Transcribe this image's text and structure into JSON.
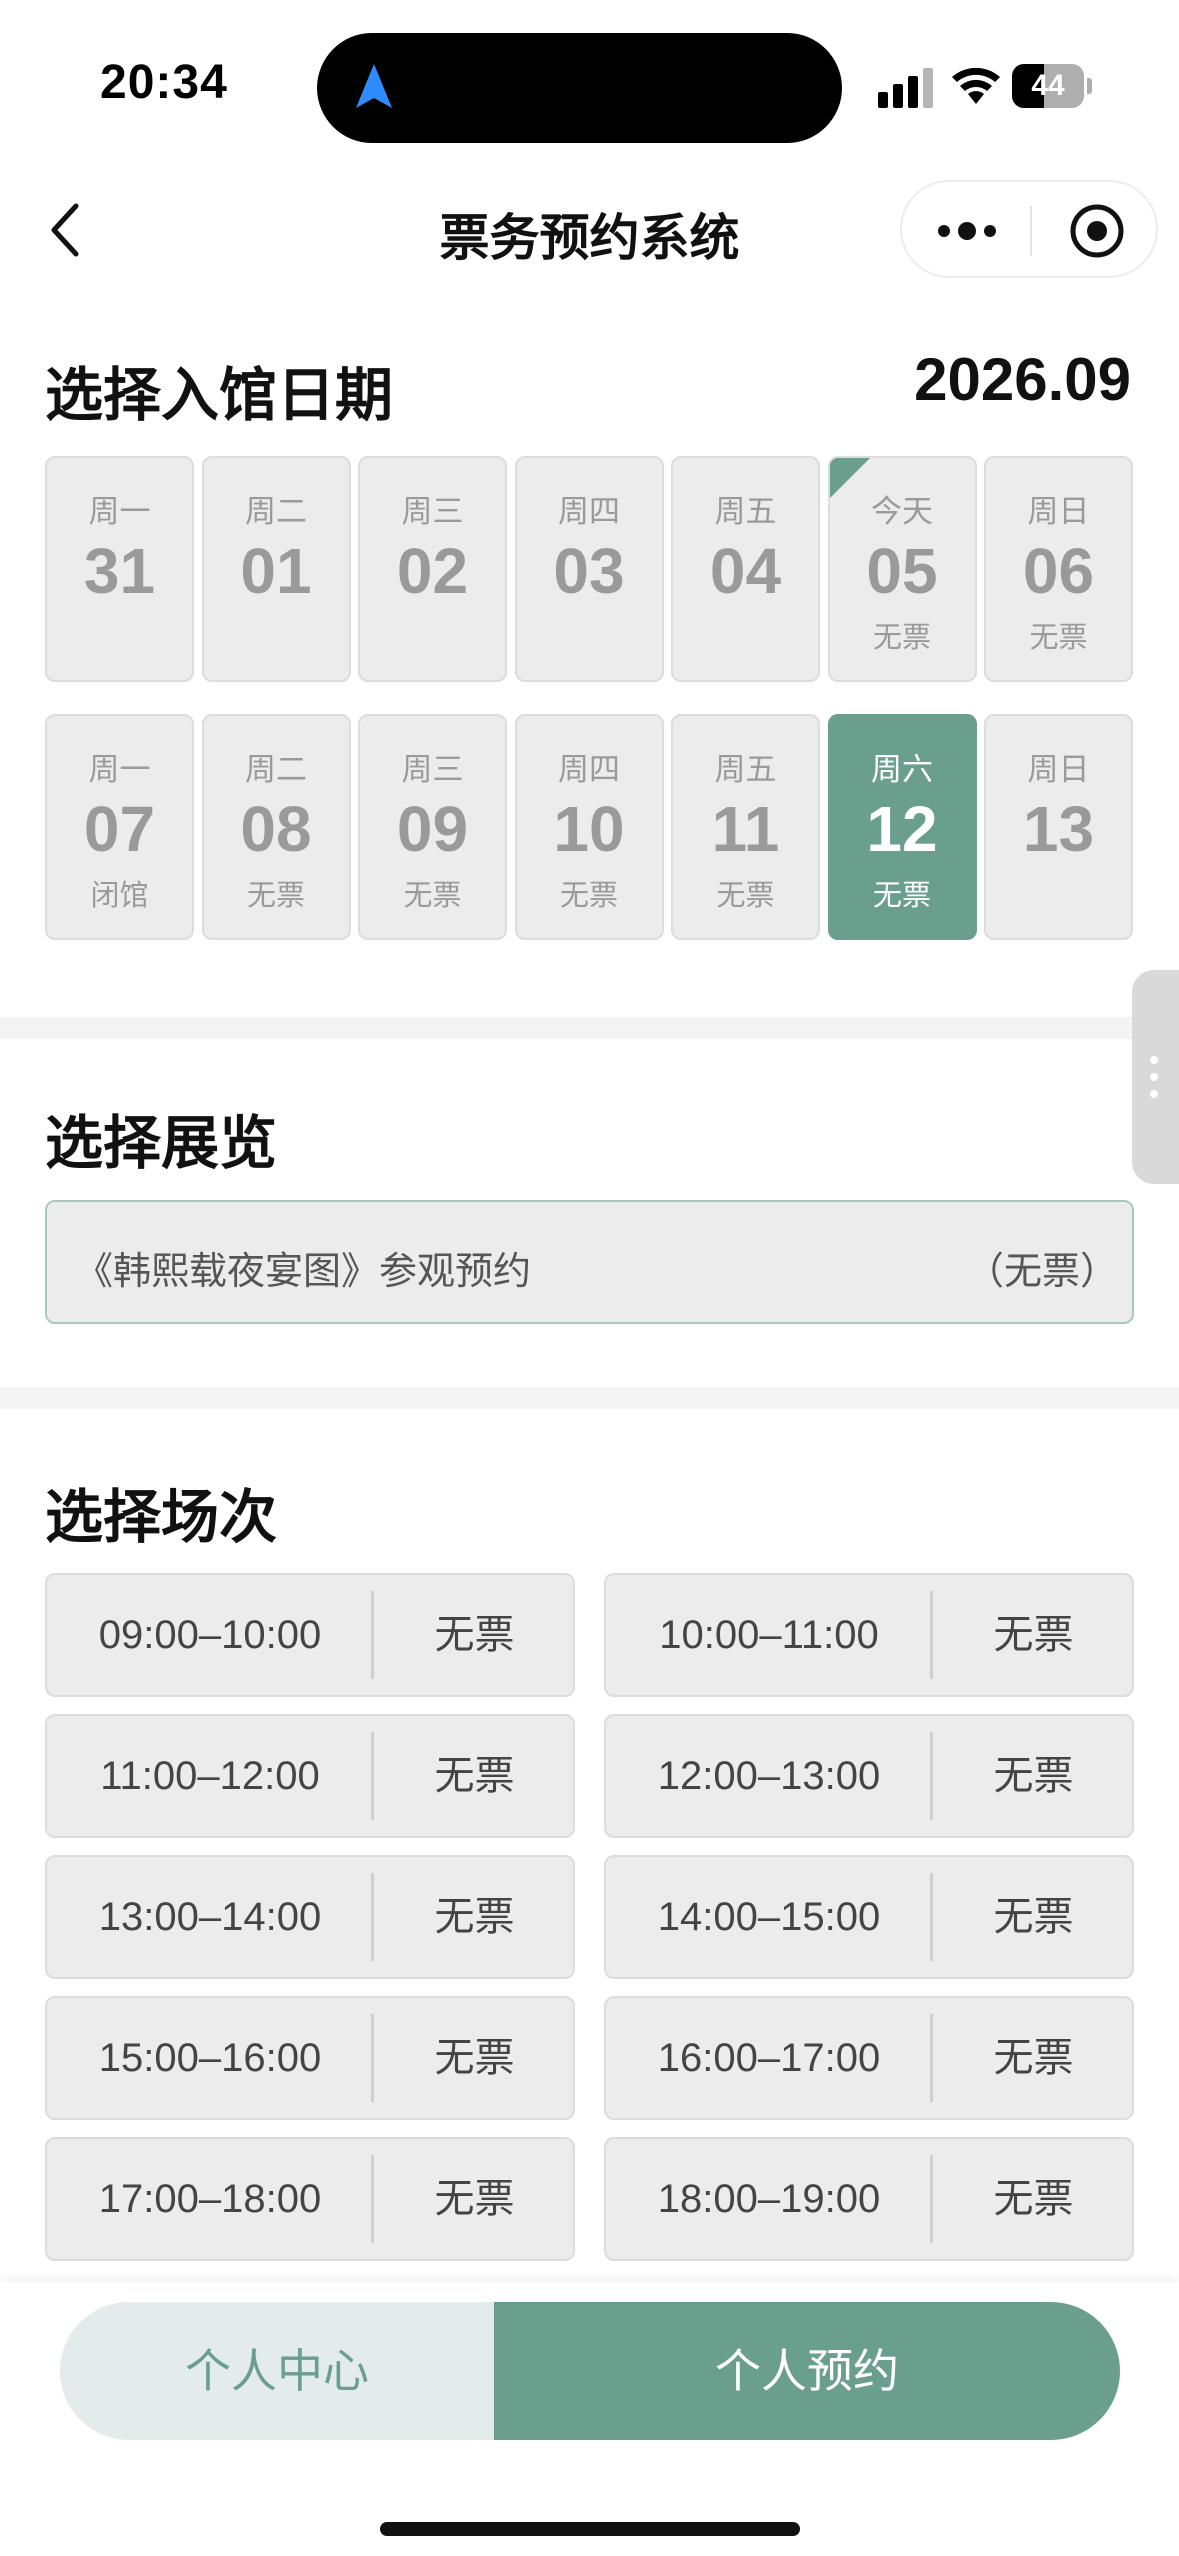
{
  "status_bar": {
    "time": "20:34",
    "battery_level": "44",
    "battery_fraction": 0.44
  },
  "header": {
    "title": "票务预约系统"
  },
  "date_section": {
    "title": "选择入馆日期",
    "month": "2026.09",
    "rows": [
      [
        {
          "weekday": "周一",
          "day": "31",
          "status": ""
        },
        {
          "weekday": "周二",
          "day": "01",
          "status": ""
        },
        {
          "weekday": "周三",
          "day": "02",
          "status": ""
        },
        {
          "weekday": "周四",
          "day": "03",
          "status": ""
        },
        {
          "weekday": "周五",
          "day": "04",
          "status": ""
        },
        {
          "weekday": "今天",
          "day": "05",
          "status": "无票"
        },
        {
          "weekday": "周日",
          "day": "06",
          "status": "无票"
        }
      ],
      [
        {
          "weekday": "周一",
          "day": "07",
          "status": "闭馆"
        },
        {
          "weekday": "周二",
          "day": "08",
          "status": "无票"
        },
        {
          "weekday": "周三",
          "day": "09",
          "status": "无票"
        },
        {
          "weekday": "周四",
          "day": "10",
          "status": "无票"
        },
        {
          "weekday": "周五",
          "day": "11",
          "status": "无票"
        },
        {
          "weekday": "周六",
          "day": "12",
          "status": "无票"
        },
        {
          "weekday": "周日",
          "day": "13",
          "status": ""
        }
      ]
    ]
  },
  "exhibit_section": {
    "title": "选择展览",
    "name": "《韩熙载夜宴图》参观预约",
    "status": "（无票）"
  },
  "session_section": {
    "title": "选择场次",
    "sessions": [
      {
        "time": "09:00–10:00",
        "status": "无票"
      },
      {
        "time": "10:00–11:00",
        "status": "无票"
      },
      {
        "time": "11:00–12:00",
        "status": "无票"
      },
      {
        "time": "12:00–13:00",
        "status": "无票"
      },
      {
        "time": "13:00–14:00",
        "status": "无票"
      },
      {
        "time": "14:00–15:00",
        "status": "无票"
      },
      {
        "time": "15:00–16:00",
        "status": "无票"
      },
      {
        "time": "16:00–17:00",
        "status": "无票"
      },
      {
        "time": "17:00–18:00",
        "status": "无票"
      },
      {
        "time": "18:00–19:00",
        "status": "无票"
      }
    ]
  },
  "bottom_tabs": {
    "left": "个人中心",
    "right": "个人预约"
  },
  "colors": {
    "accent": "#6a9e8d",
    "cell_bg": "#ececec",
    "muted_text": "#9a9a9a",
    "tab_inactive_bg": "#e3eceb"
  }
}
